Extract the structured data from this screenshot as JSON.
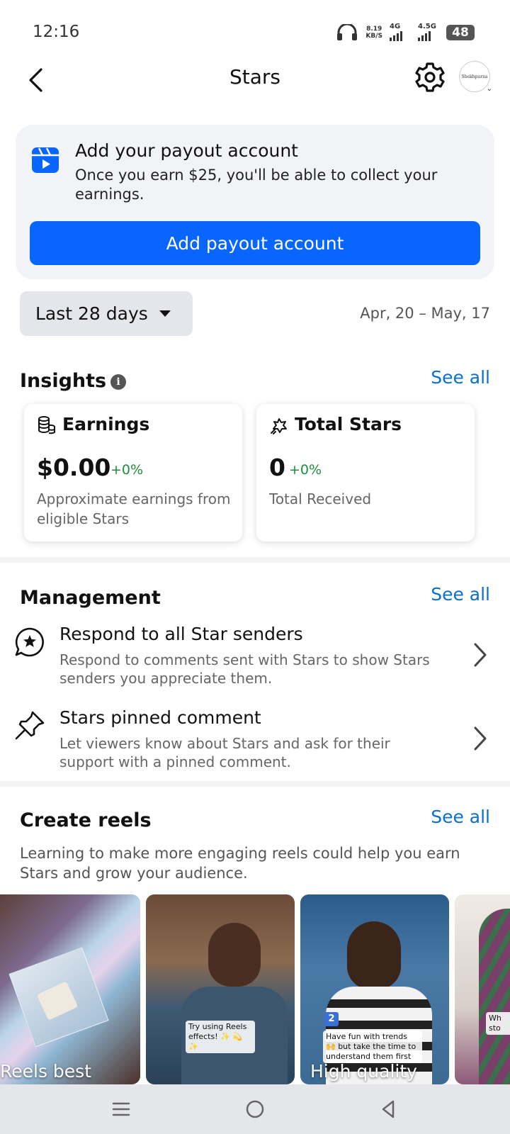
{
  "status": {
    "time": "12:16",
    "speed_value": "8.19",
    "speed_unit": "KB/S",
    "net1": "4G",
    "net2": "4.5G",
    "battery": "48"
  },
  "header": {
    "title": "Stars",
    "avatar_text": "Shekhpurna"
  },
  "payout": {
    "title": "Add your payout account",
    "description": "Once you earn $25, you'll be able to collect your earnings.",
    "button_label": "Add payout account",
    "accent_color": "#0866ff"
  },
  "period": {
    "selected": "Last 28 days",
    "date_range": "Apr, 20 – May, 17"
  },
  "insights": {
    "title": "Insights",
    "info_symbol": "i",
    "see_all": "See all",
    "cards": [
      {
        "title": "Earnings",
        "value": "$0.00",
        "change": "+0%",
        "description": "Approximate earnings from eligible Stars",
        "icon": "coins-icon"
      },
      {
        "title": "Total Stars",
        "value": "0",
        "change": "+0%",
        "description": "Total Received",
        "icon": "star-burst-icon"
      }
    ]
  },
  "management": {
    "title": "Management",
    "see_all": "See all",
    "items": [
      {
        "title": "Respond to all Star senders",
        "description": "Respond to comments sent with Stars to show Stars senders you appreciate them.",
        "icon": "star-comment-icon"
      },
      {
        "title": "Stars pinned comment",
        "description": "Let viewers know about Stars and ask for their support with a pinned comment.",
        "icon": "pin-icon"
      }
    ]
  },
  "reels": {
    "title": "Create reels",
    "see_all": "See all",
    "description": "Learning to make more engaging reels could help you earn Stars and grow your audience.",
    "items": [
      {
        "label": "Reels best",
        "caption": ""
      },
      {
        "label": "",
        "caption": "Try using Reels effects! ✨ 💫 ✨"
      },
      {
        "label": "High quality",
        "caption": "Have fun with trends 🙌 but take the time to understand them first",
        "badge": "2"
      },
      {
        "label": "",
        "caption": "Wh sto"
      }
    ]
  }
}
